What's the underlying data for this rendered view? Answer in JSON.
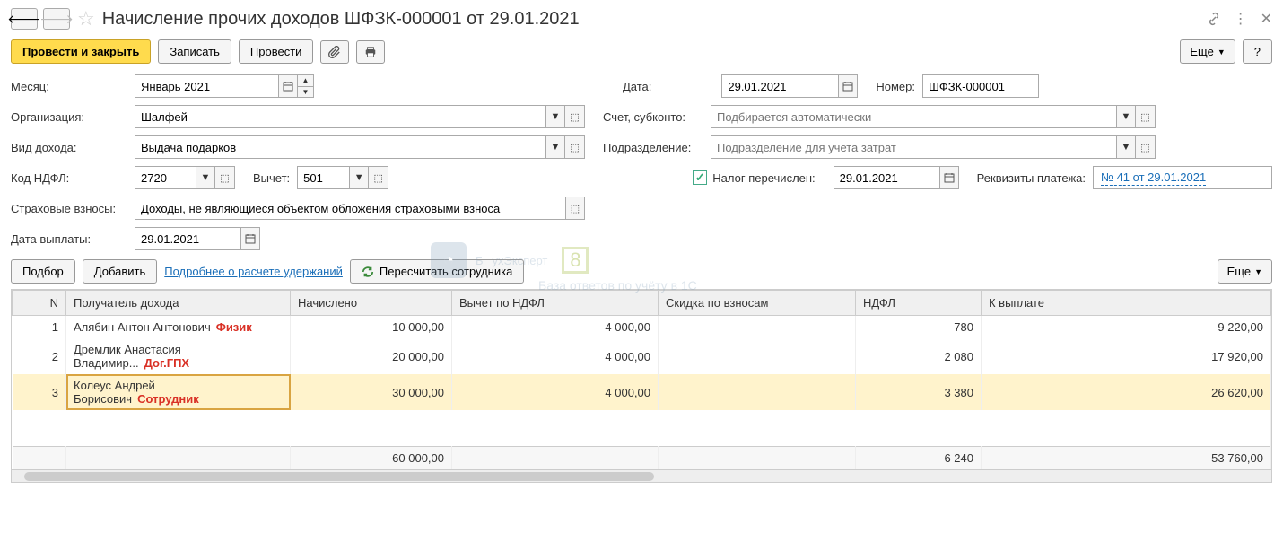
{
  "title": "Начисление прочих доходов ШФЗК-000001 от 29.01.2021",
  "toolbar": {
    "post_close": "Провести и закрыть",
    "save": "Записать",
    "post": "Провести",
    "more": "Еще",
    "help": "?"
  },
  "form": {
    "month_label": "Месяц:",
    "month_value": "Январь 2021",
    "date_label": "Дата:",
    "date_value": "29.01.2021",
    "number_label": "Номер:",
    "number_value": "ШФЗК-000001",
    "org_label": "Организация:",
    "org_value": "Шалфей",
    "account_label": "Счет, субконто:",
    "account_placeholder": "Подбирается автоматически",
    "income_type_label": "Вид дохода:",
    "income_type_value": "Выдача подарков",
    "subdivision_label": "Подразделение:",
    "subdivision_placeholder": "Подразделение для учета затрат",
    "ndfl_code_label": "Код НДФЛ:",
    "ndfl_code_value": "2720",
    "deduction_label": "Вычет:",
    "deduction_value": "501",
    "tax_paid_label": "Налог перечислен:",
    "tax_paid_date": "29.01.2021",
    "payment_details_label": "Реквизиты платежа:",
    "payment_details_value": "№ 41 от 29.01.2021",
    "insurance_label": "Страховые взносы:",
    "insurance_value": "Доходы, не являющиеся объектом обложения страховыми взноса",
    "payout_date_label": "Дата выплаты:",
    "payout_date_value": "29.01.2021"
  },
  "table_toolbar": {
    "select": "Подбор",
    "add": "Добавить",
    "details_link": "Подробнее о расчете удержаний",
    "recalc": "Пересчитать сотрудника",
    "more": "Еще"
  },
  "table": {
    "columns": [
      "N",
      "Получатель дохода",
      "Начислено",
      "Вычет по НДФЛ",
      "Скидка по взносам",
      "НДФЛ",
      "К выплате"
    ],
    "rows": [
      {
        "n": "1",
        "recipient": "Алябин Антон Антонович",
        "annotation": "Физик",
        "accrued": "10 000,00",
        "deduction": "4 000,00",
        "discount": "",
        "ndfl": "780",
        "payout": "9 220,00",
        "selected": false
      },
      {
        "n": "2",
        "recipient": "Дремлик Анастасия Владимир...",
        "annotation": "Дог.ГПХ",
        "accrued": "20 000,00",
        "deduction": "4 000,00",
        "discount": "",
        "ndfl": "2 080",
        "payout": "17 920,00",
        "selected": false
      },
      {
        "n": "3",
        "recipient": "Колеус Андрей Борисович",
        "annotation": "Сотрудник",
        "accrued": "30 000,00",
        "deduction": "4 000,00",
        "discount": "",
        "ndfl": "3 380",
        "payout": "26 620,00",
        "selected": true
      }
    ],
    "totals": {
      "accrued": "60 000,00",
      "ndfl": "6 240",
      "payout": "53 760,00"
    }
  },
  "watermark": {
    "main": "ухЭксперт",
    "sub": "База ответов по учёту в 1С"
  }
}
